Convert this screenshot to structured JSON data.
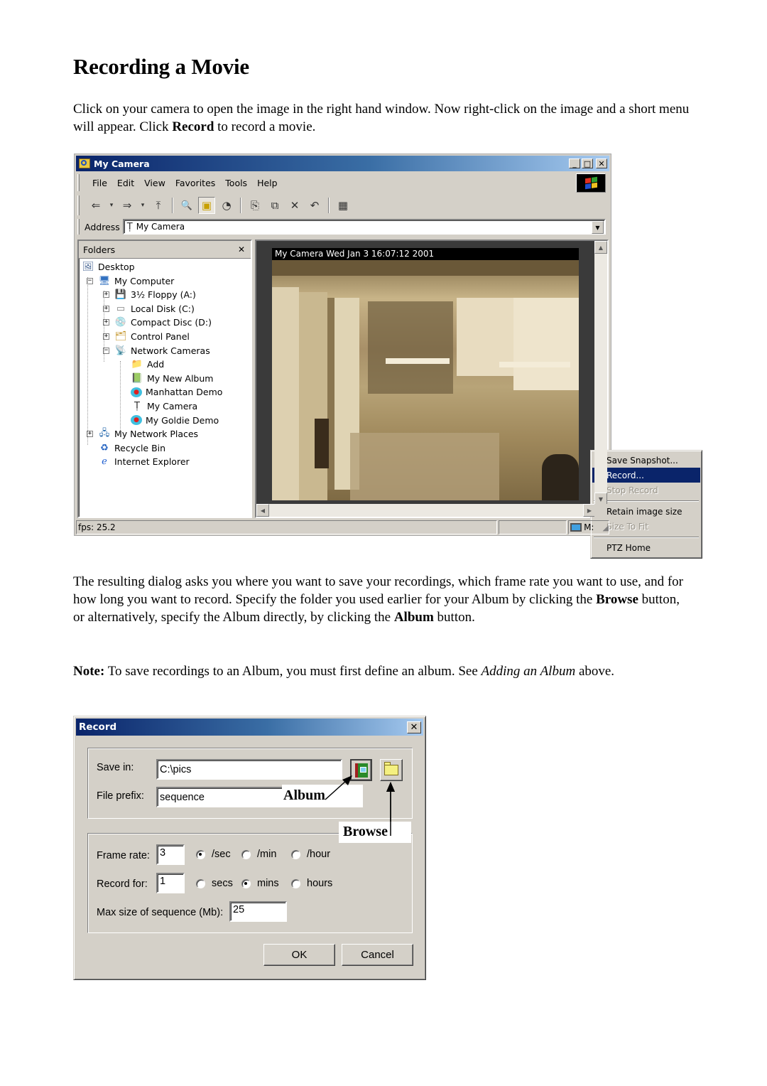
{
  "document": {
    "title": "Recording a Movie",
    "intro": {
      "part1": "Click on your camera to open the image in the right hand window. Now right-click on the image and a short menu will appear. Click ",
      "bold": "Record",
      "part2": " to record a movie."
    },
    "para2": {
      "part1": "The resulting dialog asks you where you want to save your recordings, which frame rate you want to use, and for how long you want to record. Specify the folder you used earlier for your Album by clicking the ",
      "bold1": "Browse",
      "part2": " button, or alternatively, specify the Album directly, by clicking the ",
      "bold2": "Album",
      "part3": " button."
    },
    "note": {
      "label": "Note:",
      "text": " To save recordings to an Album, you must first define an album. See ",
      "link": "Adding an Album",
      "after": " above."
    }
  },
  "explorer": {
    "title": "My Camera",
    "title_icon": "explore-icon",
    "controls": {
      "minimize": "_",
      "maximize": "□",
      "close": "✕"
    },
    "menu": [
      "File",
      "Edit",
      "View",
      "Favorites",
      "Tools",
      "Help"
    ],
    "toolbar": [
      {
        "name": "back-icon",
        "glyph": "⇐"
      },
      {
        "name": "back-dropdown-icon",
        "glyph": "▾"
      },
      {
        "name": "forward-icon",
        "glyph": "⇒"
      },
      {
        "name": "forward-dropdown-icon",
        "glyph": "▾"
      },
      {
        "name": "up-folder-icon",
        "glyph": "⤒"
      },
      {
        "name": "search-icon",
        "glyph": "🔍"
      },
      {
        "name": "folders-icon",
        "glyph": "▣"
      },
      {
        "name": "history-icon",
        "glyph": "◔"
      },
      {
        "name": "move-to-icon",
        "glyph": "⎘"
      },
      {
        "name": "copy-to-icon",
        "glyph": "⧉"
      },
      {
        "name": "delete-icon",
        "glyph": "✕"
      },
      {
        "name": "undo-icon",
        "glyph": "↶"
      },
      {
        "name": "views-icon",
        "glyph": "▦"
      }
    ],
    "address": {
      "label": "Address",
      "value": "My Camera",
      "icon": "camera-icon"
    },
    "folders_pane": {
      "title": "Folders",
      "close": "✕",
      "items": [
        {
          "label": "Desktop",
          "icon": "desktop-icon",
          "glyph": "🖼"
        },
        {
          "label": "My Computer",
          "icon": "computer-icon",
          "glyph": "🖥",
          "expander": "−"
        },
        {
          "label": "3½ Floppy (A:)",
          "icon": "floppy-icon",
          "glyph": "💾",
          "expander": "+"
        },
        {
          "label": "Local Disk (C:)",
          "icon": "disk-icon",
          "glyph": "▭",
          "expander": "+"
        },
        {
          "label": "Compact Disc (D:)",
          "icon": "cd-icon",
          "glyph": "💿",
          "expander": "+"
        },
        {
          "label": "Control Panel",
          "icon": "control-panel-icon",
          "glyph": "🗂",
          "expander": "+"
        },
        {
          "label": "Network Cameras",
          "icon": "network-cameras-icon",
          "glyph": "📡",
          "expander": "−"
        },
        {
          "label": "Add",
          "icon": "add-folder-icon",
          "glyph": "📁"
        },
        {
          "label": "My New Album",
          "icon": "album-icon",
          "glyph": "📗"
        },
        {
          "label": "Manhattan Demo",
          "icon": "demo-camera-icon",
          "glyph": "●"
        },
        {
          "label": "My Camera",
          "icon": "camera-icon",
          "glyph": "Ṭ"
        },
        {
          "label": "My Goldie Demo",
          "icon": "demo-camera-icon",
          "glyph": "●"
        },
        {
          "label": "My Network Places",
          "icon": "network-places-icon",
          "glyph": "🖧",
          "expander": "+"
        },
        {
          "label": "Recycle Bin",
          "icon": "recycle-bin-icon",
          "glyph": "♻"
        },
        {
          "label": "Internet Explorer",
          "icon": "ie-icon",
          "glyph": "ℯ"
        }
      ]
    },
    "camera": {
      "caption": "My Camera Wed Jan  3 16:07:12 2001"
    },
    "context_menu": {
      "items": [
        {
          "label": "Save Snapshot...",
          "state": "normal"
        },
        {
          "label": "Record...",
          "state": "selected"
        },
        {
          "label": "Stop Record",
          "state": "disabled"
        },
        {
          "separator": true
        },
        {
          "label": "Retain image size",
          "state": "checked"
        },
        {
          "label": "Size To Fit",
          "state": "disabled"
        },
        {
          "separator": true
        },
        {
          "label": "PTZ Home",
          "state": "normal"
        }
      ]
    },
    "status": {
      "fps": "fps: 25.2",
      "zone": "M:"
    }
  },
  "record_dialog": {
    "title": "Record",
    "close": "✕",
    "save_in": {
      "label": "Save in:",
      "value": "C:\\pics"
    },
    "file_prefix": {
      "label": "File prefix:",
      "value": "sequence"
    },
    "frame_rate": {
      "label": "Frame rate:",
      "value": "3",
      "options": [
        "/sec",
        "/min",
        "/hour"
      ],
      "selected": "/sec"
    },
    "record_for": {
      "label": "Record for:",
      "value": "1",
      "options": [
        "secs",
        "mins",
        "hours"
      ],
      "selected": "mins"
    },
    "max_size": {
      "label": "Max size of sequence (Mb):",
      "value": "25"
    },
    "ok": "OK",
    "cancel": "Cancel",
    "callouts": {
      "album": "Album",
      "browse": "Browse"
    }
  },
  "colors": {
    "title_active_start": "#0a246a",
    "title_active_end": "#a6caf0",
    "face": "#d4d0c8",
    "menu_highlight": "#0a246a"
  }
}
